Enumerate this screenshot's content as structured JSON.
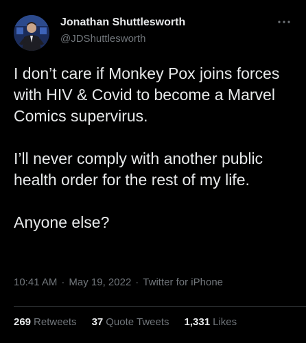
{
  "user": {
    "display_name": "Jonathan Shuttlesworth",
    "handle": "@JDShuttlesworth"
  },
  "tweet": {
    "paragraphs": [
      "I don’t care if Monkey Pox joins forces with HIV & Covid to become a Marvel Comics supervirus.",
      "I’ll never comply with another public health order for the rest of my life.",
      "Anyone else?"
    ],
    "time": "10:41 AM",
    "date": "May 19, 2022",
    "source": "Twitter for iPhone",
    "separator": "·"
  },
  "stats": {
    "retweets": {
      "count": "269",
      "label": "Retweets"
    },
    "quote_tweets": {
      "count": "37",
      "label": "Quote Tweets"
    },
    "likes": {
      "count": "1,331",
      "label": "Likes"
    }
  },
  "icons": {
    "more": "more-options-icon"
  },
  "colors": {
    "background": "#000000",
    "primary_text": "#e7e9ea",
    "secondary_text": "#71767b",
    "divider": "#2f3336"
  }
}
